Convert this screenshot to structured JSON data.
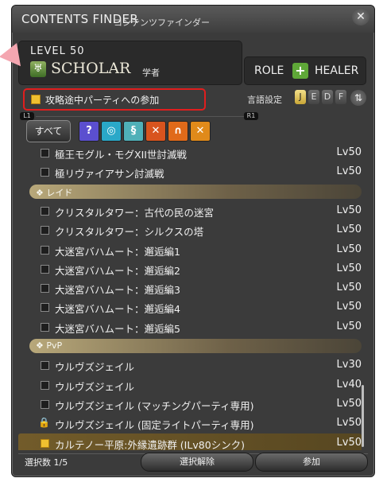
{
  "window": {
    "title": "CONTENTS FINDER",
    "title_sub": "コンテンツファインダー",
    "close_icon": "close-x-icon"
  },
  "player": {
    "level_text": "LEVEL 50",
    "job_icon_glyph": "♅",
    "job_name": "SCHOLAR",
    "job_sub": "学者"
  },
  "role": {
    "label": "ROLE",
    "icon_glyph": "+",
    "name": "HEALER"
  },
  "join_in_progress": {
    "label": "攻略途中パーティへの参加",
    "checked": true
  },
  "language": {
    "label": "言語設定",
    "options": [
      "J",
      "E",
      "D",
      "F"
    ],
    "active": "J",
    "sort_glyph": "⇅"
  },
  "hints": {
    "left": "L1",
    "right": "R1"
  },
  "filters": {
    "all_label": "すべて",
    "icons": [
      {
        "name": "roulette-icon",
        "glyph": "?",
        "color": "#5b4fcf"
      },
      {
        "name": "dungeon-icon",
        "glyph": "◎",
        "color": "#2aa8c8"
      },
      {
        "name": "guildhest-icon",
        "glyph": "§",
        "color": "#4fb0b8"
      },
      {
        "name": "trial-icon",
        "glyph": "✕",
        "color": "#d8541e"
      },
      {
        "name": "raid-icon",
        "glyph": "∩",
        "color": "#e06a1a"
      },
      {
        "name": "pvp-icon",
        "glyph": "✕",
        "color": "#e08a1a"
      }
    ]
  },
  "list": [
    {
      "type": "item",
      "name": "極王モグル・モグXII世討滅戦",
      "level": "Lv50",
      "state": "unchecked"
    },
    {
      "type": "item",
      "name": "極リヴァイアサン討滅戦",
      "level": "Lv50",
      "state": "unchecked"
    },
    {
      "type": "header",
      "name": "❖ レイド"
    },
    {
      "type": "item",
      "name": "クリスタルタワー：古代の民の迷宮",
      "level": "Lv50",
      "state": "unchecked"
    },
    {
      "type": "item",
      "name": "クリスタルタワー：シルクスの塔",
      "level": "Lv50",
      "state": "unchecked"
    },
    {
      "type": "item",
      "name": "大迷宮バハムート：邂逅編1",
      "level": "Lv50",
      "state": "unchecked"
    },
    {
      "type": "item",
      "name": "大迷宮バハムート：邂逅編2",
      "level": "Lv50",
      "state": "unchecked"
    },
    {
      "type": "item",
      "name": "大迷宮バハムート：邂逅編3",
      "level": "Lv50",
      "state": "unchecked"
    },
    {
      "type": "item",
      "name": "大迷宮バハムート：邂逅編4",
      "level": "Lv50",
      "state": "unchecked"
    },
    {
      "type": "item",
      "name": "大迷宮バハムート：邂逅編5",
      "level": "Lv50",
      "state": "unchecked"
    },
    {
      "type": "header",
      "name": "❖ PvP"
    },
    {
      "type": "item",
      "name": "ウルヴズジェイル",
      "level": "Lv30",
      "state": "unchecked"
    },
    {
      "type": "item",
      "name": "ウルヴズジェイル",
      "level": "Lv40",
      "state": "unchecked"
    },
    {
      "type": "item",
      "name": "ウルヴズジェイル (マッチングパーティ専用)",
      "level": "Lv50",
      "state": "unchecked"
    },
    {
      "type": "item",
      "name": "ウルヴズジェイル (固定ライトパーティ専用)",
      "level": "Lv50",
      "state": "locked"
    },
    {
      "type": "item",
      "name": "カルテノー平原:外縁遺跡群 (ILv80シンク)",
      "level": "Lv50",
      "state": "checked",
      "highlight": true
    }
  ],
  "footer": {
    "selection_count": "選択数 1/5",
    "clear_label": "選択解除",
    "join_label": "参加"
  },
  "colors": {
    "highlight_box": "#e01e1e",
    "checkbox_on": "#f0c030",
    "role_healer": "#5fa838"
  }
}
